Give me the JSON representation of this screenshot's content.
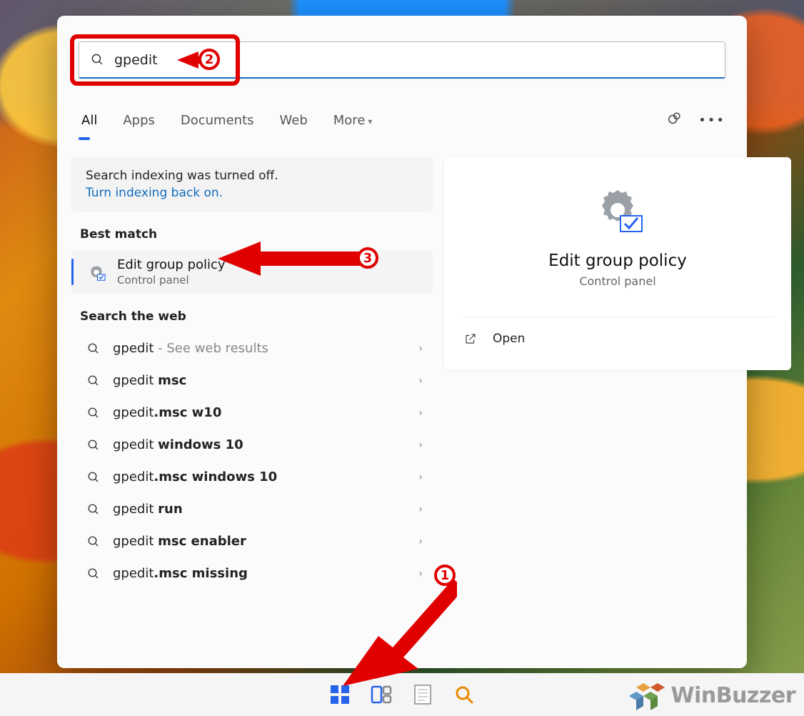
{
  "search": {
    "value": "gpedit"
  },
  "tabs": {
    "all": "All",
    "apps": "Apps",
    "documents": "Documents",
    "web": "Web",
    "more": "More"
  },
  "indexing": {
    "message": "Search indexing was turned off.",
    "link": "Turn indexing back on."
  },
  "sections": {
    "best_match": "Best match",
    "search_web": "Search the web"
  },
  "best_match": {
    "title": "Edit group policy",
    "subtitle": "Control panel"
  },
  "web_items": {
    "item0": {
      "prefix": "gpedit",
      "suffix": " - See web results"
    },
    "item1": {
      "prefix": "gpedit ",
      "bold": "msc"
    },
    "item2": {
      "prefix": "gpedit",
      "bold": ".msc w10"
    },
    "item3": {
      "prefix": "gpedit ",
      "bold": "windows 10"
    },
    "item4": {
      "prefix": "gpedit",
      "bold": ".msc windows 10"
    },
    "item5": {
      "prefix": "gpedit ",
      "bold": "run"
    },
    "item6": {
      "prefix": "gpedit ",
      "bold": "msc enabler"
    },
    "item7": {
      "prefix": "gpedit",
      "bold": ".msc missing"
    }
  },
  "preview": {
    "title": "Edit group policy",
    "subtitle": "Control panel",
    "open": "Open"
  },
  "watermark": {
    "text": "WinBuzzer"
  },
  "annotations": {
    "c1": "1",
    "c2": "2",
    "c3": "3"
  }
}
